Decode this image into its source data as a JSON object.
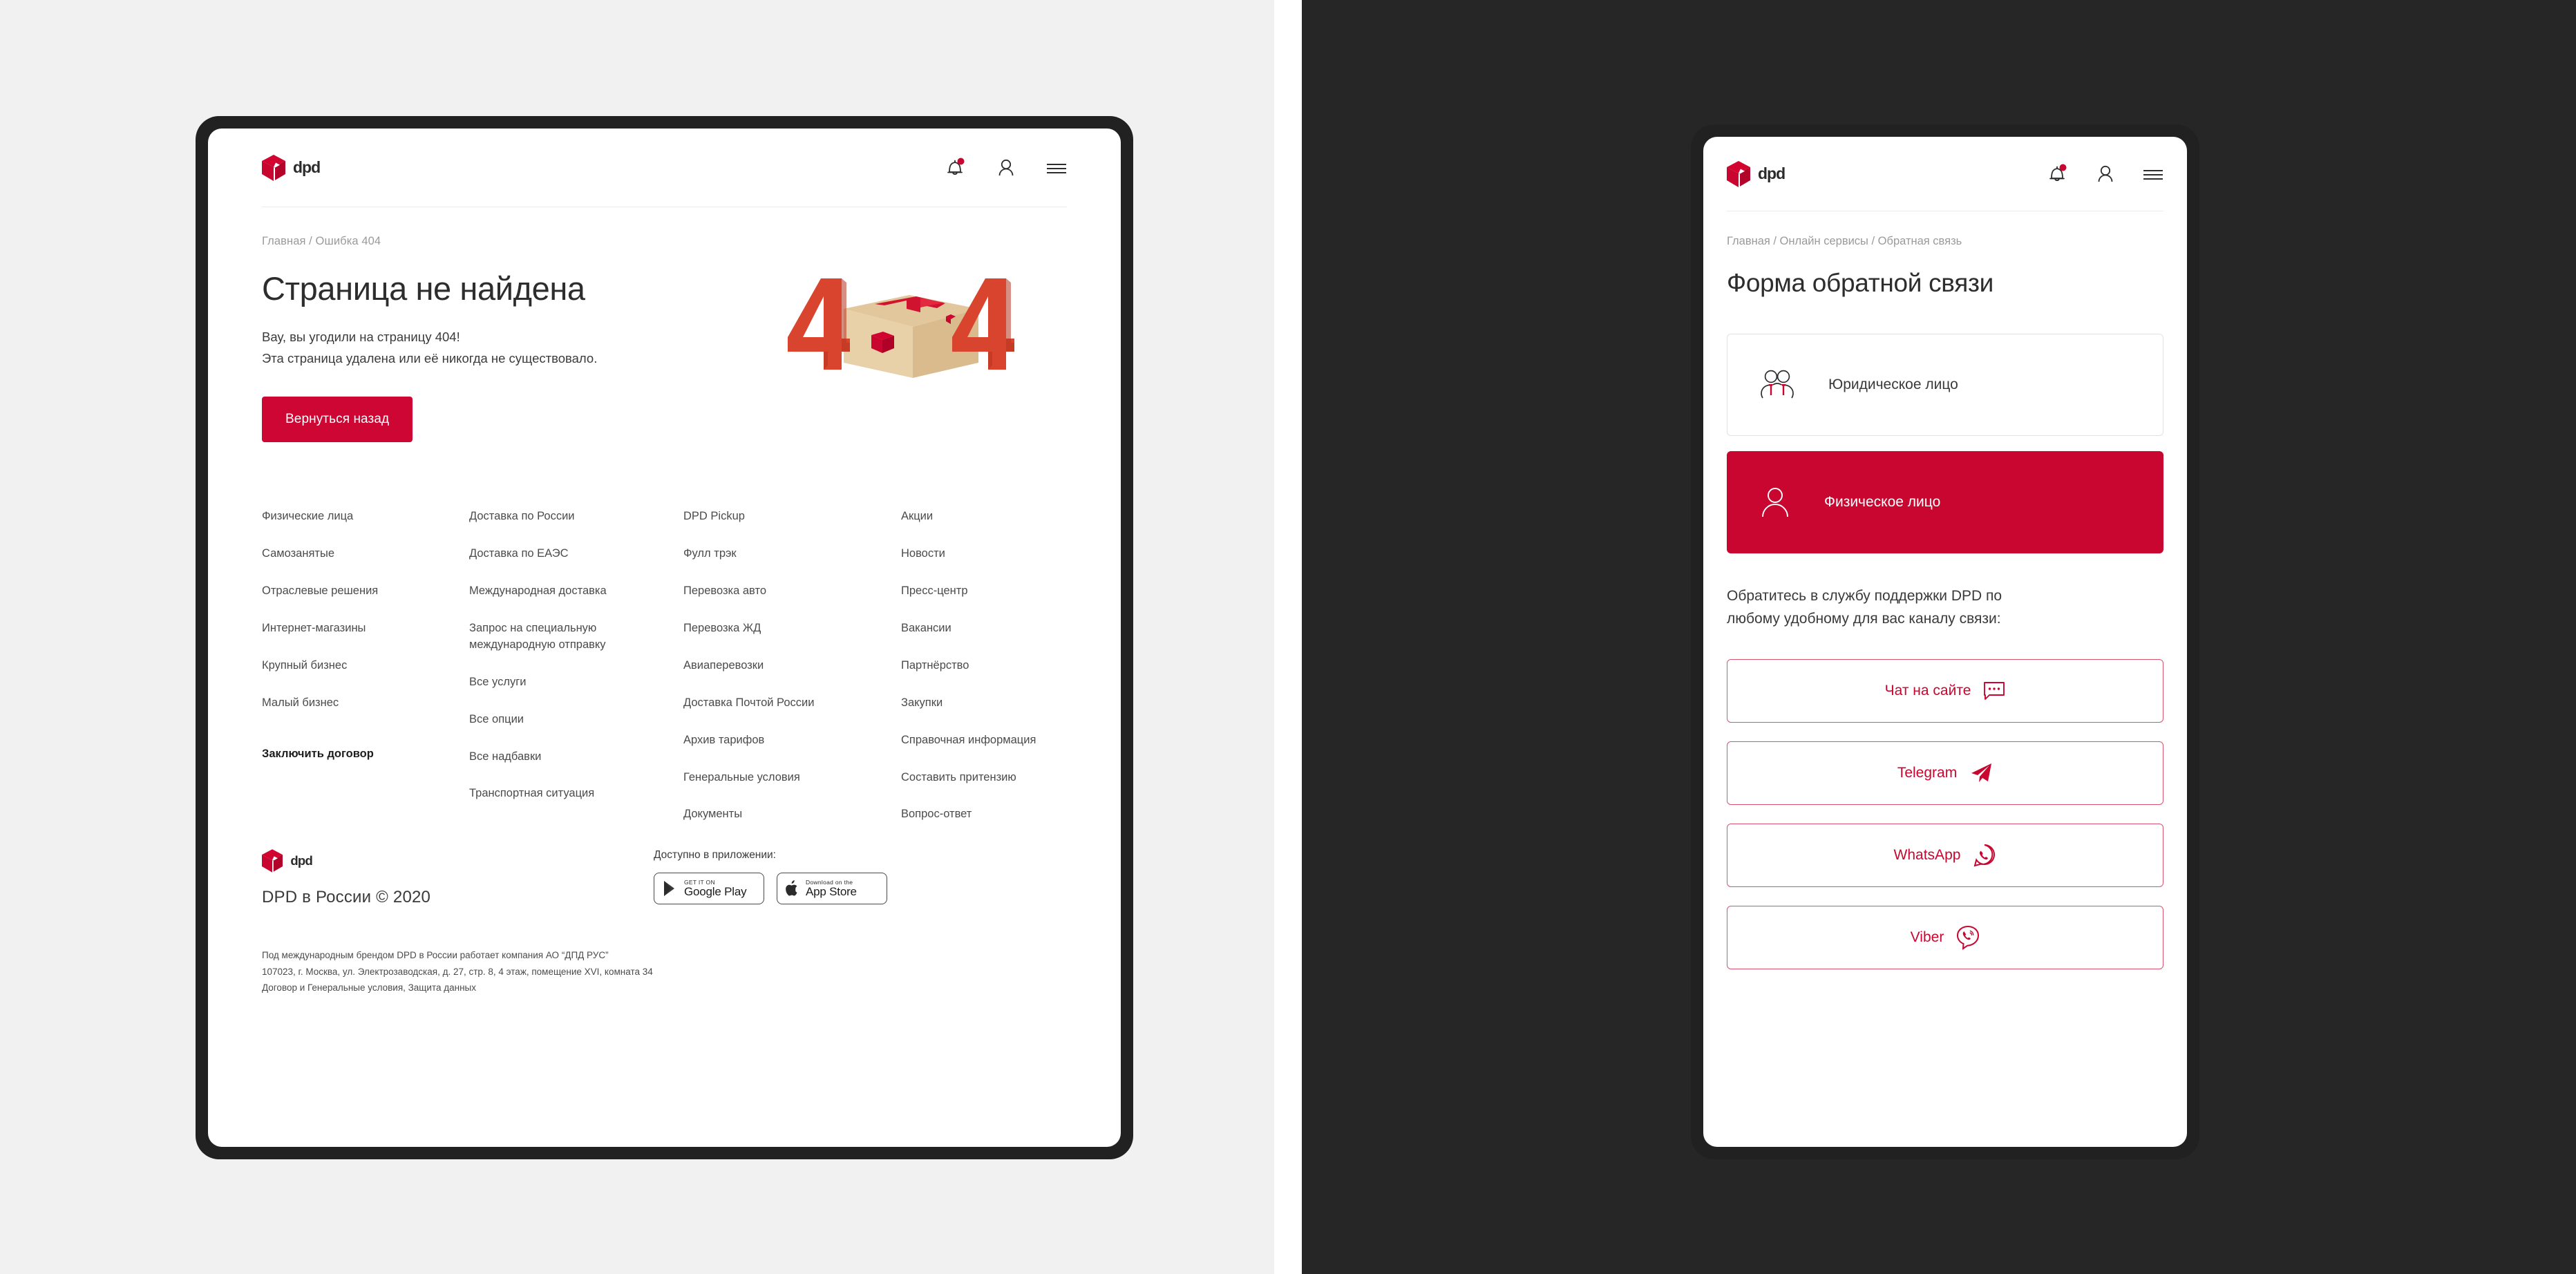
{
  "theme": {
    "brand_red": "#c8062f",
    "button_red": "#cd0633",
    "dark_frame": "#212121",
    "page_bg_left": "#f1f1f1",
    "page_bg_right": "#262626",
    "text_dark": "#2d2d2d",
    "text_muted": "#9a9a9a"
  },
  "desktop": {
    "logo_alt": "dpd",
    "header_icons": [
      {
        "name": "notifications-bell-icon",
        "badge": true
      },
      {
        "name": "user-account-icon",
        "badge": false
      },
      {
        "name": "hamburger-menu-icon",
        "badge": false
      }
    ],
    "breadcrumb": "Главная / Ошибка 404",
    "title": "Страница не найдена",
    "subtitle_line1": "Вау, вы угодили на страницу 404!",
    "subtitle_line2": "Эта страница удалена или её никогда не существовало.",
    "back_button": "Вернуться назад",
    "illustration": "404-cardboard-box",
    "footer_columns": [
      {
        "links": [
          {
            "label": "Физические лица",
            "bold": false
          },
          {
            "label": "Самозанятые",
            "bold": false
          },
          {
            "label": "Отраслевые решения",
            "bold": false
          },
          {
            "label": "Интернет-магазины",
            "bold": false
          },
          {
            "label": "Крупный бизнес",
            "bold": false
          },
          {
            "label": "Малый бизнес",
            "bold": false
          },
          {
            "label": "Заключить договор",
            "bold": true
          }
        ]
      },
      {
        "links": [
          {
            "label": "Доставка по России",
            "bold": false
          },
          {
            "label": "Доставка по ЕАЭС",
            "bold": false
          },
          {
            "label": "Международная доставка",
            "bold": false
          },
          {
            "label": "Запрос на специальную международную отправку",
            "bold": false
          },
          {
            "label": "Все услуги",
            "bold": false
          },
          {
            "label": "Все опции",
            "bold": false
          },
          {
            "label": "Все надбавки",
            "bold": false
          },
          {
            "label": "Транспортная ситуация",
            "bold": false
          }
        ]
      },
      {
        "links": [
          {
            "label": "DPD Pickup",
            "bold": false
          },
          {
            "label": "Фулл трэк",
            "bold": false
          },
          {
            "label": "Перевозка авто",
            "bold": false
          },
          {
            "label": "Перевозка ЖД",
            "bold": false
          },
          {
            "label": "Авиаперевозки",
            "bold": false
          },
          {
            "label": "Доставка Почтой России",
            "bold": false
          },
          {
            "label": "Архив тарифов",
            "bold": false
          },
          {
            "label": "Генеральные условия",
            "bold": false
          },
          {
            "label": "Документы",
            "bold": false
          }
        ]
      },
      {
        "links": [
          {
            "label": "Акции",
            "bold": false
          },
          {
            "label": "Новости",
            "bold": false
          },
          {
            "label": "Пресс-центр",
            "bold": false
          },
          {
            "label": "Вакансии",
            "bold": false
          },
          {
            "label": "Партнёрство",
            "bold": false
          },
          {
            "label": "Закупки",
            "bold": false
          },
          {
            "label": "Справочная информация",
            "bold": false
          },
          {
            "label": "Составить притензию",
            "bold": false
          },
          {
            "label": "Вопрос-ответ",
            "bold": false
          }
        ]
      }
    ],
    "copyright": "DPD в России © 2020",
    "apps_label": "Доступно в приложении:",
    "store_badges": [
      {
        "icon": "google-play-icon",
        "small": "GET IT ON",
        "large": "Google Play"
      },
      {
        "icon": "apple-icon",
        "small": "Download on the",
        "large": "App Store"
      }
    ],
    "legal": [
      "Под международным брендом DPD в России работает компания АО “ДПД РУС”",
      "107023, г. Москва, ул. Электрозаводская, д. 27, стр. 8, 4 этаж, помещение XVI, комната 34",
      "Договор и Генеральные условия, Защита данных"
    ]
  },
  "mobile": {
    "logo_alt": "dpd",
    "header_icons": [
      {
        "name": "notifications-bell-icon",
        "badge": true
      },
      {
        "name": "user-account-icon",
        "badge": false
      },
      {
        "name": "hamburger-menu-icon",
        "badge": false
      }
    ],
    "breadcrumb": "Главная / Онлайн сервисы / Обратная связь",
    "title": "Форма обратной связи",
    "entity_options": [
      {
        "label": "Юридическое лицо",
        "icon": "two-people-tie-icon",
        "selected": false
      },
      {
        "label": "Физическое лицо",
        "icon": "single-person-icon",
        "selected": true
      }
    ],
    "support_text_line1": "Обратитесь в службу поддержки DPD по",
    "support_text_line2": "любому удобному для вас каналу связи:",
    "channels": [
      {
        "label": "Чат на сайте",
        "icon": "chat-bubble-icon"
      },
      {
        "label": "Telegram",
        "icon": "telegram-icon"
      },
      {
        "label": "WhatsApp",
        "icon": "whatsapp-icon"
      },
      {
        "label": "Viber",
        "icon": "viber-icon"
      }
    ]
  }
}
